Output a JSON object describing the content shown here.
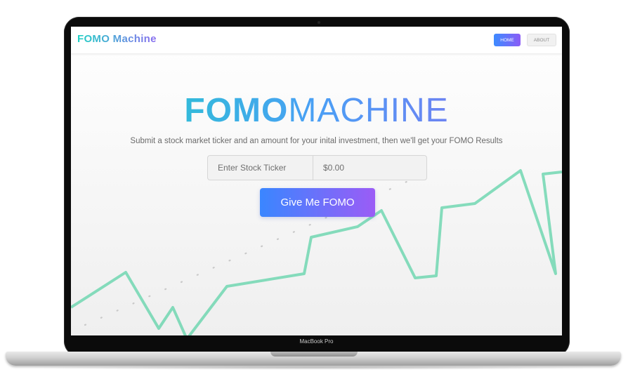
{
  "device": {
    "label": "MacBook Pro"
  },
  "navbar": {
    "brand": "FOMO Machine",
    "links": [
      {
        "label": "HOME",
        "active": true
      },
      {
        "label": "ABOUT",
        "active": false
      }
    ]
  },
  "hero": {
    "title_bold": "FOMO",
    "title_light": "MACHINE",
    "subtitle": "Submit a stock market ticker and an amount for your inital investment, then we'll get your FOMO Results"
  },
  "form": {
    "ticker_placeholder": "Enter Stock Ticker",
    "amount_placeholder": "$0.00",
    "submit_label": "Give Me FOMO"
  },
  "colors": {
    "accent_teal": "#1fd1c4",
    "accent_blue": "#3a86ff",
    "accent_purple": "#8a6cf0",
    "chart_line": "#5fd3a8"
  }
}
